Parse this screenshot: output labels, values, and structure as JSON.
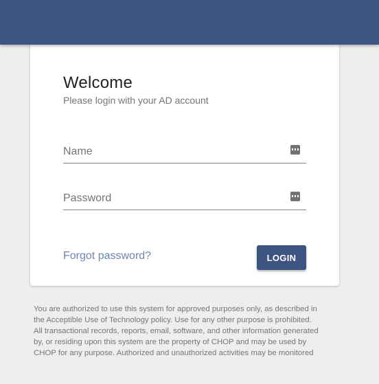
{
  "header": {
    "background_color": "#3d5480"
  },
  "login_card": {
    "title": "Welcome",
    "subtitle": "Please login with your AD account",
    "name_field": {
      "placeholder": "Name",
      "value": "",
      "icon": "password-manager-icon"
    },
    "password_field": {
      "placeholder": "Password",
      "value": "",
      "icon": "password-manager-icon"
    },
    "forgot_password_label": "Forgot password?",
    "login_button_label": "LOGIN"
  },
  "disclaimer": {
    "lines": [
      "You are authorized to use this system for approved purposes only, as described in",
      "the Acceptible Use of Technology policy. Use for any other purpose is prohibited.",
      "All transactional records, reports, email, software, and other information generated",
      "by, or residing upon this system are the property of CHOP and may be used by",
      "CHOP for any purpose. Authorized and unauthorized activities may be monitored"
    ]
  },
  "colors": {
    "primary": "#3d5480",
    "link": "#6b86b3",
    "page_background": "#eeeeee"
  }
}
